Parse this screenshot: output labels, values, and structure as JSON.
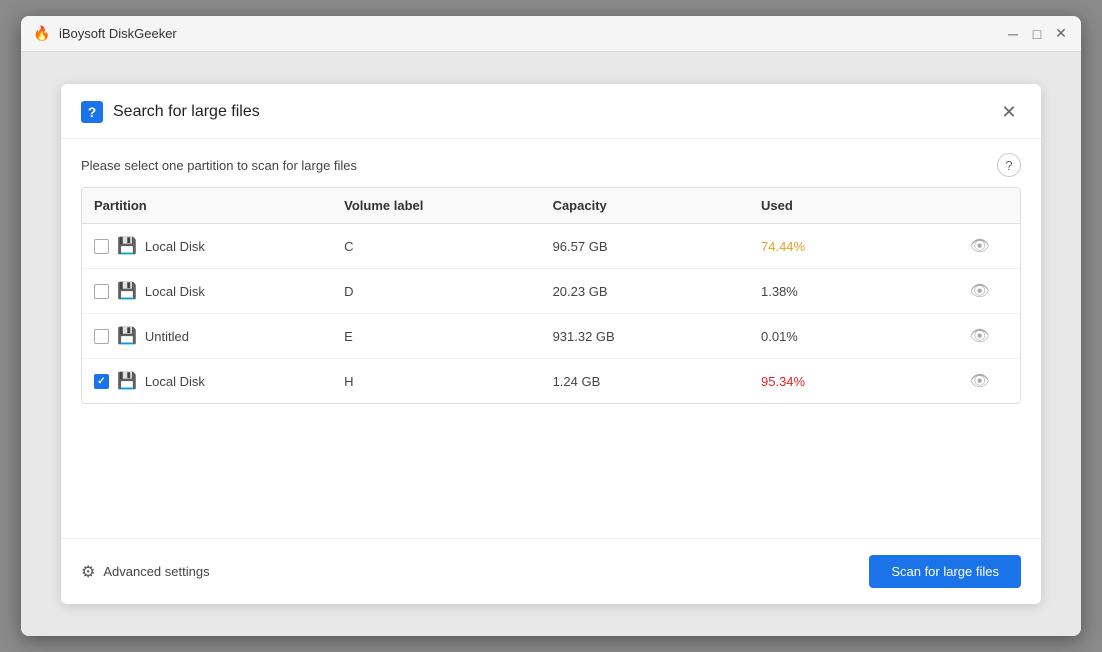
{
  "app": {
    "title": "iBoysoft DiskGeeker",
    "icon": "🔥"
  },
  "titlebar": {
    "minimize_label": "─",
    "maximize_label": "□",
    "close_label": "✕"
  },
  "dialog": {
    "icon_label": "?",
    "title": "Search for large files",
    "close_label": "✕",
    "subtitle": "Please select one partition to scan for large files",
    "help_label": "?",
    "table": {
      "columns": [
        {
          "key": "partition",
          "label": "Partition"
        },
        {
          "key": "volume_label",
          "label": "Volume label"
        },
        {
          "key": "capacity",
          "label": "Capacity"
        },
        {
          "key": "used",
          "label": "Used"
        },
        {
          "key": "action",
          "label": ""
        }
      ],
      "rows": [
        {
          "id": "row-c",
          "checked": false,
          "partition_name": "Local Disk",
          "volume_label": "C",
          "capacity": "96.57 GB",
          "used": "74.44%",
          "used_style": "orange"
        },
        {
          "id": "row-d",
          "checked": false,
          "partition_name": "Local Disk",
          "volume_label": "D",
          "capacity": "20.23 GB",
          "used": "1.38%",
          "used_style": "normal"
        },
        {
          "id": "row-e",
          "checked": false,
          "partition_name": "Untitled",
          "volume_label": "E",
          "capacity": "931.32 GB",
          "used": "0.01%",
          "used_style": "normal"
        },
        {
          "id": "row-h",
          "checked": true,
          "partition_name": "Local Disk",
          "volume_label": "H",
          "capacity": "1.24 GB",
          "used": "95.34%",
          "used_style": "red"
        }
      ]
    },
    "footer": {
      "advanced_settings_label": "Advanced settings",
      "scan_button_label": "Scan for large files"
    }
  }
}
